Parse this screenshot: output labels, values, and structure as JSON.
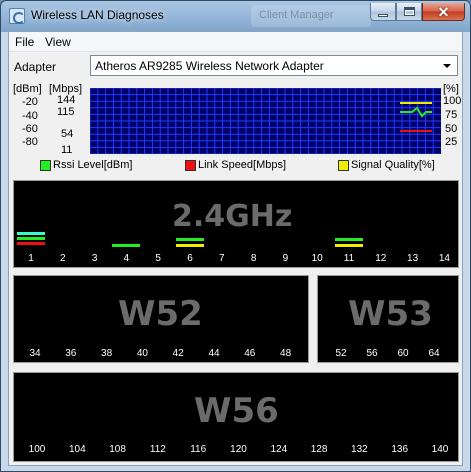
{
  "window": {
    "title": "Wireless LAN Diagnoses",
    "background_tab": "Client Manager",
    "close_glyph": "✕"
  },
  "menu": {
    "file": "File",
    "view": "View"
  },
  "adapter": {
    "label": "Adapter",
    "selected": "Atheros AR9285 Wireless Network Adapter"
  },
  "graph": {
    "left_units_dbm": "[dBm]",
    "left_units_mbps": "[Mbps]",
    "dbm_ticks": [
      "-20",
      "-40",
      "-60",
      "-80"
    ],
    "mbps_ticks": [
      "144",
      "115",
      "54",
      "11"
    ],
    "right_units": "[%]",
    "pct_ticks": [
      "100",
      "75",
      "50",
      "25"
    ],
    "colors": {
      "background": "#000066",
      "grid": "#1f3cff"
    }
  },
  "legend": [
    {
      "label": "Rssi Level[dBm]",
      "color": "#22ee22"
    },
    {
      "label": "Link Speed[Mbps]",
      "color": "#ee1111"
    },
    {
      "label": "Signal Quality[%]",
      "color": "#eeee00"
    }
  ],
  "bands": {
    "g24": {
      "title": "2.4GHz",
      "channels": [
        "1",
        "2",
        "3",
        "4",
        "5",
        "6",
        "7",
        "8",
        "9",
        "10",
        "11",
        "12",
        "13",
        "14"
      ]
    },
    "w52": {
      "title": "W52",
      "channels": [
        "34",
        "36",
        "38",
        "40",
        "42",
        "44",
        "46",
        "48"
      ]
    },
    "w53": {
      "title": "W53",
      "channels": [
        "52",
        "56",
        "60",
        "64"
      ]
    },
    "w56": {
      "title": "W56",
      "channels": [
        "100",
        "104",
        "108",
        "112",
        "116",
        "120",
        "124",
        "128",
        "132",
        "136",
        "140"
      ]
    }
  },
  "colors": {
    "rssi": "#22ee22",
    "speed": "#ee1111",
    "quality": "#eeee00",
    "cyan": "#33ffcc"
  }
}
